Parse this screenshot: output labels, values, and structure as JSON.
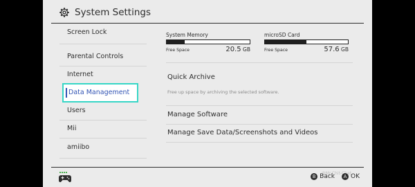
{
  "header": {
    "title": "System Settings",
    "icon": "gear-icon"
  },
  "sidebar": {
    "items": [
      {
        "label": "Screen Lock"
      },
      {
        "label": "Parental Controls"
      },
      {
        "label": "Internet"
      },
      {
        "label": "Data Management",
        "selected": true
      },
      {
        "label": "Users"
      },
      {
        "label": "Mii"
      },
      {
        "label": "amiibo"
      }
    ]
  },
  "storage": {
    "system": {
      "label": "System Memory",
      "free_label": "Free Space",
      "free_value": "20.5",
      "unit": "GB",
      "used_fraction": 0.22
    },
    "sd": {
      "label": "microSD Card",
      "free_label": "Free Space",
      "free_value": "57.6",
      "unit": "GB",
      "used_fraction": 0.5
    }
  },
  "content": {
    "quick_archive": "Quick Archive",
    "quick_archive_desc": "Free up space by archiving the selected software.",
    "manage_software": "Manage Software",
    "manage_save_data": "Manage Save Data/Screenshots and Videos"
  },
  "footer": {
    "back_label": "Back",
    "back_button": "B",
    "ok_label": "OK",
    "ok_button": "A",
    "watermark": "@Mr.Chit-Chat"
  },
  "colors": {
    "background": "#ebebeb",
    "selection_border": "#36d6c6",
    "selection_text": "#3254b4",
    "text": "#2d2d2d"
  }
}
